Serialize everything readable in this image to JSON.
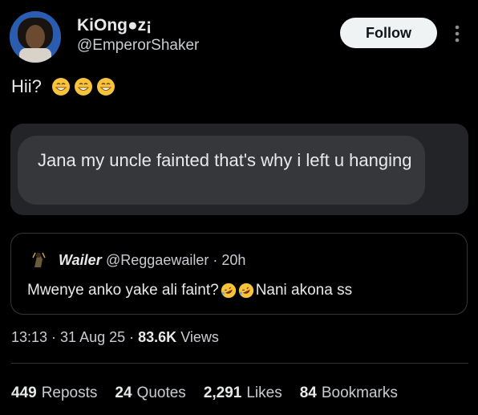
{
  "author": {
    "display_name": "KiOng●z¡",
    "handle": "@EmperorShaker",
    "follow_label": "Follow"
  },
  "tweet": {
    "text": "Hii?",
    "emojis": [
      "grin-sweat-emoji",
      "grin-sweat-emoji",
      "grin-sweat-emoji"
    ]
  },
  "chat_card": {
    "message": "Jana my uncle fainted that's why i left u hanging"
  },
  "quote": {
    "name": "Wailer",
    "handle": "@Reggaewailer · 20h",
    "text": "Mwenye anko yake ali faint?",
    "trailing_text": "Nani akona ss",
    "emojis": [
      "rofl-emoji",
      "rofl-emoji"
    ]
  },
  "meta": {
    "time": "13:13",
    "date": "31 Aug 25",
    "views_count": "83.6K",
    "views_label": "Views"
  },
  "stats": {
    "reposts_count": "449",
    "reposts_label": "Reposts",
    "quotes_count": "24",
    "quotes_label": "Quotes",
    "likes_count": "2,291",
    "likes_label": "Likes",
    "bookmarks_count": "84",
    "bookmarks_label": "Bookmarks"
  }
}
